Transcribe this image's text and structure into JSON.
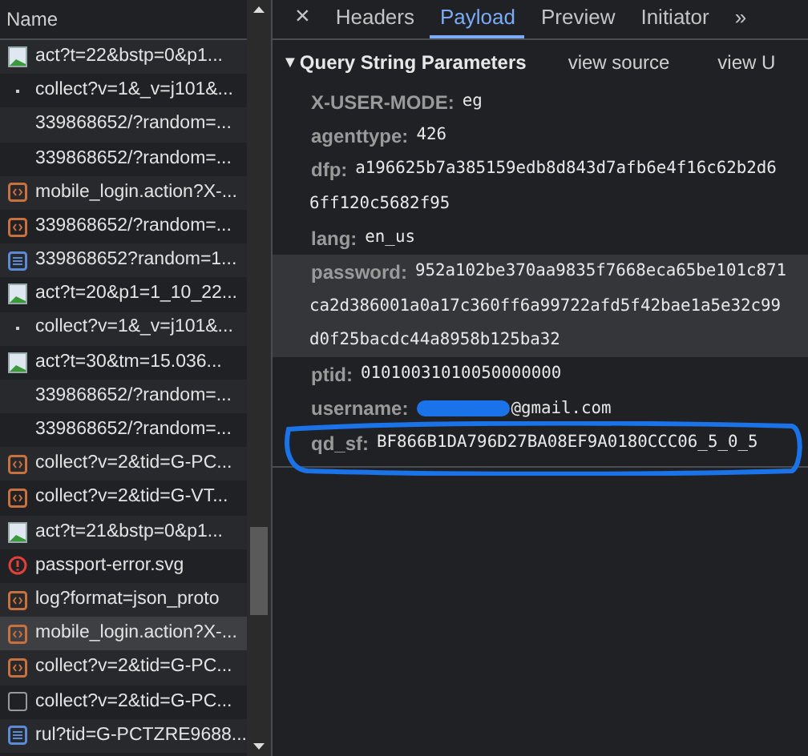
{
  "requests": {
    "header": "Name",
    "rows": [
      {
        "name": "act?t=22&bstp=0&p1...",
        "kind": "image",
        "selected": false
      },
      {
        "name": "collect?v=1&_v=j101&...",
        "kind": "dot",
        "selected": false
      },
      {
        "name": "339868652/?random=...",
        "kind": "none",
        "selected": false
      },
      {
        "name": "339868652/?random=...",
        "kind": "none",
        "selected": false
      },
      {
        "name": "mobile_login.action?X-...",
        "kind": "xhr",
        "selected": false
      },
      {
        "name": "339868652/?random=...",
        "kind": "xhr",
        "selected": false
      },
      {
        "name": "339868652?random=1...",
        "kind": "document",
        "selected": false
      },
      {
        "name": "act?t=20&p1=1_10_22...",
        "kind": "image",
        "selected": false
      },
      {
        "name": "collect?v=1&_v=j101&...",
        "kind": "dot",
        "selected": false
      },
      {
        "name": "act?t=30&tm=15.036...",
        "kind": "image",
        "selected": false
      },
      {
        "name": "339868652/?random=...",
        "kind": "none",
        "selected": false
      },
      {
        "name": "339868652/?random=...",
        "kind": "none",
        "selected": false
      },
      {
        "name": "collect?v=2&tid=G-PC...",
        "kind": "xhr",
        "selected": false
      },
      {
        "name": "collect?v=2&tid=G-VT...",
        "kind": "xhr",
        "selected": false
      },
      {
        "name": "act?t=21&bstp=0&p1...",
        "kind": "image",
        "selected": false
      },
      {
        "name": "passport-error.svg",
        "kind": "error",
        "selected": false
      },
      {
        "name": "log?format=json_proto",
        "kind": "xhr",
        "selected": false
      },
      {
        "name": "mobile_login.action?X-...",
        "kind": "xhr",
        "selected": true
      },
      {
        "name": "collect?v=2&tid=G-PC...",
        "kind": "xhr",
        "selected": false
      },
      {
        "name": "collect?v=2&tid=G-PC...",
        "kind": "other",
        "selected": false
      },
      {
        "name": "rul?tid=G-PCTZRE9688...",
        "kind": "document",
        "selected": false
      }
    ]
  },
  "tabs": [
    {
      "label": "×",
      "kind": "close",
      "selected": false
    },
    {
      "label": "Headers",
      "kind": "tab",
      "selected": false
    },
    {
      "label": "Payload",
      "kind": "tab",
      "selected": true
    },
    {
      "label": "Preview",
      "kind": "tab",
      "selected": false
    },
    {
      "label": "Initiator",
      "kind": "tab",
      "selected": false
    },
    {
      "label": "»",
      "kind": "more",
      "selected": false
    }
  ],
  "section": {
    "arrow": "▼",
    "title": "Query String Parameters",
    "expanded": true,
    "links": [
      "view source",
      "view U"
    ]
  },
  "params": [
    {
      "key": "X-USER-MODE:",
      "lines": [
        "eg"
      ]
    },
    {
      "key": "agenttype:",
      "lines": [
        "426"
      ]
    },
    {
      "key": "dfp:",
      "lines": [
        "a196625b7a385159edb8d843d7afb6e4f16c62b2d6",
        "6ff120c5682f95"
      ]
    },
    {
      "key": "lang:",
      "lines": [
        "en_us"
      ]
    },
    {
      "key": "password:",
      "lines": [
        "952a102be370aa9835f7668eca65be101c871",
        "ca2d386001a0a17c360ff6a99722afd5f42bae1a5e32c99",
        "d0f25bacdc44a8958b125ba32"
      ],
      "highlighted": true
    },
    {
      "key": "ptid:",
      "lines": [
        "01010031010050000000"
      ]
    },
    {
      "key": "username:",
      "lines": [
        "@gmail.com"
      ],
      "redacted": true
    },
    {
      "key": "qd_sf:",
      "lines": [
        "BF866B1DA796D27BA08EF9A0180CCC06_5_0_5"
      ],
      "circled": true
    }
  ]
}
